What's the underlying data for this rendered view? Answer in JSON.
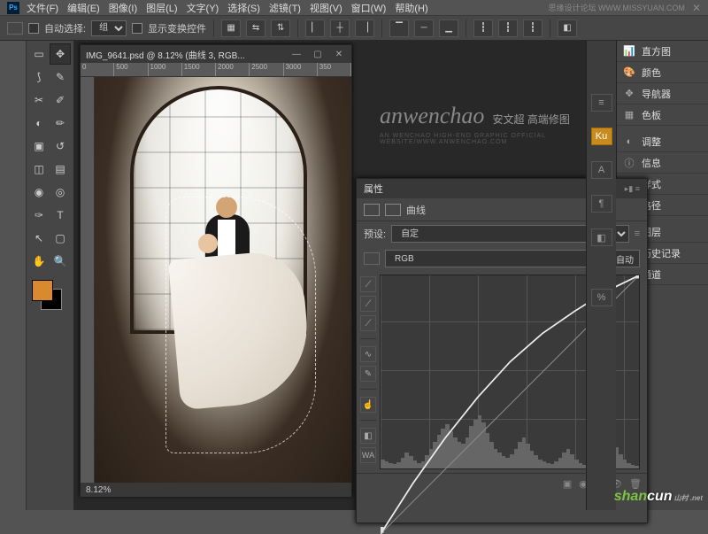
{
  "topbar": {
    "menus": [
      "文件(F)",
      "编辑(E)",
      "图像(I)",
      "图层(L)",
      "文字(Y)",
      "选择(S)",
      "滤镜(T)",
      "视图(V)",
      "窗口(W)",
      "帮助(H)"
    ],
    "right_text": "思缘设计论坛  WWW.MISSYUAN.COM"
  },
  "options": {
    "auto_select_label": "自动选择:",
    "group_option": "组",
    "transform_label": "显示变换控件"
  },
  "doc": {
    "title": "IMG_9641.psd @ 8.12% (曲线 3, RGB...",
    "ruler_marks": [
      "0",
      "500",
      "1000",
      "1500",
      "2000",
      "2500",
      "3000",
      "350"
    ],
    "zoom": "8.12%"
  },
  "brand": {
    "en": "anwenchao",
    "cn": "安文超 高端修图",
    "sub": "AN WENCHAO HIGH-END GRAPHIC OFFICIAL WEBSITE/WWW.ANWENCHAO.COM"
  },
  "properties": {
    "tab_label": "属性",
    "adj_label": "曲线",
    "preset_label": "预设:",
    "preset_value": "自定",
    "channel_value": "RGB",
    "auto_button": "自动"
  },
  "right_panels": {
    "items": [
      "直方图",
      "颜色",
      "导航器",
      "色板",
      "调整",
      "信息",
      "样式",
      "路径",
      "图层",
      "历史记录",
      "通道"
    ]
  },
  "collapsed_tabs": [
    "Ku"
  ],
  "watermark": {
    "p1": "shan",
    "p2": "cun",
    "sub": "山村\n.net"
  },
  "chart_data": {
    "type": "line",
    "title": "曲线",
    "xlabel": "",
    "ylabel": "",
    "xlim": [
      0,
      255
    ],
    "ylim": [
      0,
      255
    ],
    "series": [
      {
        "name": "baseline",
        "x": [
          0,
          255
        ],
        "y": [
          0,
          255
        ]
      },
      {
        "name": "curve",
        "x": [
          0,
          32,
          64,
          96,
          128,
          160,
          192,
          224,
          255
        ],
        "y": [
          0,
          50,
          95,
          135,
          170,
          198,
          220,
          240,
          255
        ]
      }
    ],
    "histogram_heights": [
      10,
      8,
      6,
      5,
      7,
      12,
      18,
      14,
      9,
      6,
      8,
      15,
      22,
      30,
      38,
      45,
      50,
      42,
      35,
      30,
      28,
      35,
      48,
      55,
      60,
      52,
      40,
      30,
      22,
      18,
      14,
      12,
      16,
      22,
      30,
      35,
      28,
      20,
      15,
      10,
      8,
      6,
      5,
      8,
      12,
      18,
      22,
      16,
      10,
      6,
      4,
      3,
      5,
      8,
      12,
      18,
      25,
      30,
      24,
      16,
      10,
      6,
      4,
      3
    ]
  }
}
